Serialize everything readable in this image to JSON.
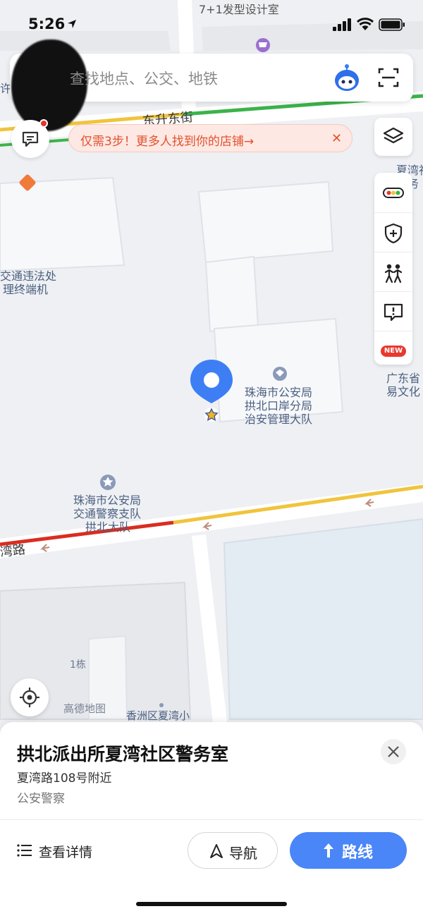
{
  "status_bar": {
    "time": "5:26"
  },
  "search": {
    "placeholder": "查找地点、公交、地铁"
  },
  "promo": {
    "text": "仅需3步！更多人找到你的店铺→",
    "close": "✕"
  },
  "tools": {
    "new_badge": "NEW"
  },
  "map_labels": {
    "top_shop": "7+1发型设计室",
    "partial_left": "许",
    "street_top": "东升东街",
    "traffic_office_1": "交通违法处",
    "traffic_office_2": "理终端机",
    "community_right_1": "夏湾社",
    "community_right_2": "服务",
    "police_poi_1": "珠海市公安局",
    "police_poi_2": "拱北口岸分局",
    "police_poi_3": "治安管理大队",
    "culture_right_1": "广东省",
    "culture_right_2": "易文化",
    "traffic_police_1": "珠海市公安局",
    "traffic_police_2": "交通警察支队",
    "traffic_police_3": "拱北大队",
    "street_bottom": "湾路",
    "building_1": "1栋",
    "watermark": "高德地图",
    "school": "香洲区夏湾小"
  },
  "place": {
    "name": "拱北派出所夏湾社区警务室",
    "address": "夏湾路108号附近",
    "category": "公安警察"
  },
  "actions": {
    "details": "查看详情",
    "navigate": "导航",
    "route": "路线"
  },
  "colors": {
    "accent": "#4a86f7",
    "traffic_green": "#3cb34a",
    "traffic_yellow": "#f0c43c",
    "traffic_red": "#d92d20",
    "promo_text": "#e2512d"
  }
}
